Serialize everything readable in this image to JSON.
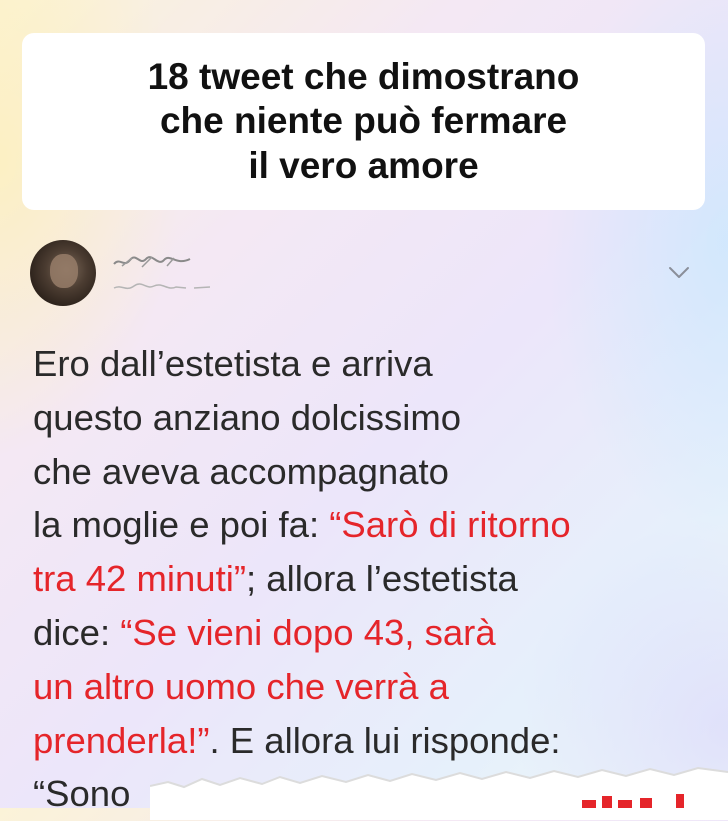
{
  "title": {
    "text": "18 tweet che dimostrano\nche niente può fermare\nil vero amore"
  },
  "tweet": {
    "author_name": "",
    "author_handle": "",
    "menu_icon": "chevron-down-icon",
    "body": [
      {
        "segments": [
          {
            "text": "Ero dall’estetista e arriva",
            "color": "#2a2a2a"
          }
        ]
      },
      {
        "segments": [
          {
            "text": "questo anziano dolcissimo",
            "color": "#2a2a2a"
          }
        ]
      },
      {
        "segments": [
          {
            "text": "che aveva accompagnato",
            "color": "#2a2a2a"
          }
        ]
      },
      {
        "segments": [
          {
            "text": "la moglie e poi fa: ",
            "color": "#2a2a2a"
          },
          {
            "text": "“Sarò di ritorno",
            "color": "#e5252a"
          }
        ]
      },
      {
        "segments": [
          {
            "text": "tra 42 minuti”",
            "color": "#e5252a"
          },
          {
            "text": "; allora l’estetista",
            "color": "#2a2a2a"
          }
        ]
      },
      {
        "segments": [
          {
            "text": "dice: ",
            "color": "#2a2a2a"
          },
          {
            "text": "“Se vieni dopo 43, sarà",
            "color": "#e5252a"
          }
        ]
      },
      {
        "segments": [
          {
            "text": "un altro uomo che verrà a",
            "color": "#e5252a"
          }
        ]
      },
      {
        "segments": [
          {
            "text": "prenderla!”",
            "color": "#e5252a"
          },
          {
            "text": ". E allora lui risponde:",
            "color": "#2a2a2a"
          }
        ]
      },
      {
        "segments": [
          {
            "text": "“Sono",
            "color": "#2a2a2a"
          }
        ]
      }
    ]
  },
  "colors": {
    "accent_red": "#e5252a",
    "text": "#2a2a2a",
    "card": "#ffffff"
  }
}
